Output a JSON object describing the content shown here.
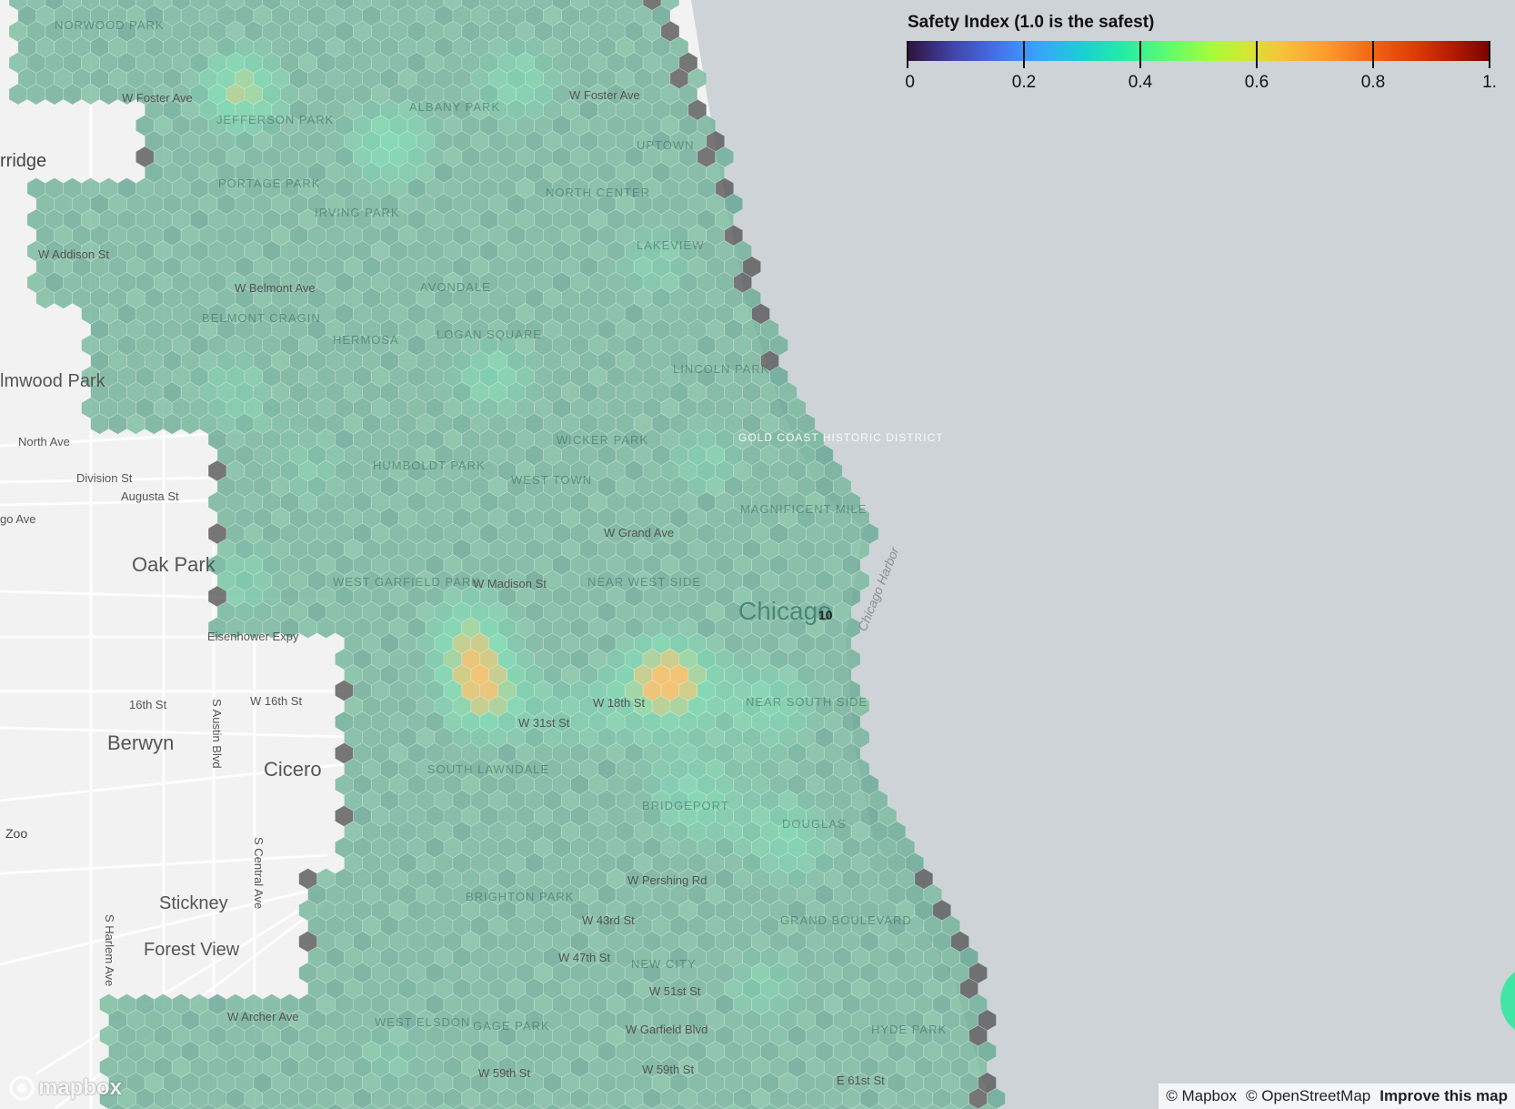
{
  "legend": {
    "title": "Safety Index (1.0 is the safest)",
    "ticks": [
      ".0",
      "0.2",
      "0.4",
      "0.6",
      "0.8",
      "1."
    ],
    "tick_values": [
      0.0,
      0.2,
      0.4,
      0.6,
      0.8,
      1.0
    ],
    "colormap": "turbo"
  },
  "places": {
    "oak_park": "Oak Park",
    "berwyn": "Berwyn",
    "cicero": "Cicero",
    "stickney": "Stickney",
    "forest_view": "Forest View",
    "elmwood_park": "lmwood Park",
    "ridge": "rridge",
    "zoo": "Zoo",
    "chicago": "Chicago",
    "chicago_harbor": "Chicago Harbor",
    "north_ave": "North Ave",
    "division_st": "Division St",
    "augusta_st": "Augusta St",
    "go_ave": "go Ave",
    "16th_st": "16th St",
    "w_16th_st": "W 16th St",
    "austin_blvd": "S Austin Blvd",
    "central_ave": "S Central Ave",
    "harlem_ave": "S Harlem Ave",
    "eisenhower": "Eisenhower Expy",
    "w_foster_ave_1": "W Foster Ave",
    "w_foster_ave_2": "W Foster Ave",
    "w_addison_st": "W Addison St",
    "w_belmont_ave": "W Belmont Ave",
    "w_grand_ave": "W Grand Ave",
    "w_madison_st": "W Madison St",
    "w_18th_st": "W 18th St",
    "w_31st_st": "W 31st St",
    "w_pershing_rd": "W Pershing Rd",
    "w_43rd_st": "W 43rd St",
    "w_47th_st": "W 47th St",
    "w_51st_st": "W 51st St",
    "w_garfield_blvd": "W Garfield Blvd",
    "w_59th_st_1": "W 59th St",
    "w_59th_st_2": "W 59th St",
    "e_61st_st": "E 61st St",
    "w_archer_ave": "W Archer Ave",
    "hood_norwood": "NORWOOD PARK",
    "hood_jefferson": "JEFFERSON PARK",
    "hood_portage": "PORTAGE PARK",
    "hood_irving": "IRVING PARK",
    "hood_uptown": "UPTOWN",
    "hood_lakeview": "LAKEVIEW",
    "hood_avondale": "AVONDALE",
    "hood_logan": "LOGAN SQUARE",
    "hood_hermosa": "HERMOSA",
    "hood_belmont_cragin": "BELMONT CRAGIN",
    "hood_humboldt": "HUMBOLDT PARK",
    "hood_wicker": "WICKER PARK",
    "hood_west_town": "WEST TOWN",
    "hood_gold_coast": "GOLD COAST HISTORIC DISTRICT",
    "hood_magnificent": "MAGNIFICENT MILE",
    "hood_west_garfield": "WEST GARFIELD PARK",
    "hood_near_west": "NEAR WEST SIDE",
    "hood_near_south": "NEAR SOUTH SIDE",
    "hood_south_lawndale": "SOUTH LAWNDALE",
    "hood_bridgeport": "BRIDGEPORT",
    "hood_douglas": "DOUGLAS",
    "hood_brighton": "BRIGHTON PARK",
    "hood_grand_blvd": "GRAND BOULEVARD",
    "hood_new_city": "NEW CITY",
    "hood_hyde_park": "HYDE PARK",
    "hood_west_elsdon": "WEST ELSDON",
    "hood_gage_park": "GAGE PARK",
    "hood_lincoln_park": "LINCOLN PARK",
    "hood_north_center": "NORTH CENTER",
    "hood_albany": "ALBANY PARK",
    "route_10": "10"
  },
  "attribution": {
    "mapbox": "© Mapbox",
    "osm": "© OpenStreetMap",
    "improve": "Improve this map"
  },
  "logo": "mapbox",
  "colors": {
    "water": "#cdd3d6",
    "land": "#f2f2f2",
    "hex_base": "#6fb49c",
    "hex_dark": "#5e5e5e",
    "hex_hot": "#f5b04a"
  }
}
